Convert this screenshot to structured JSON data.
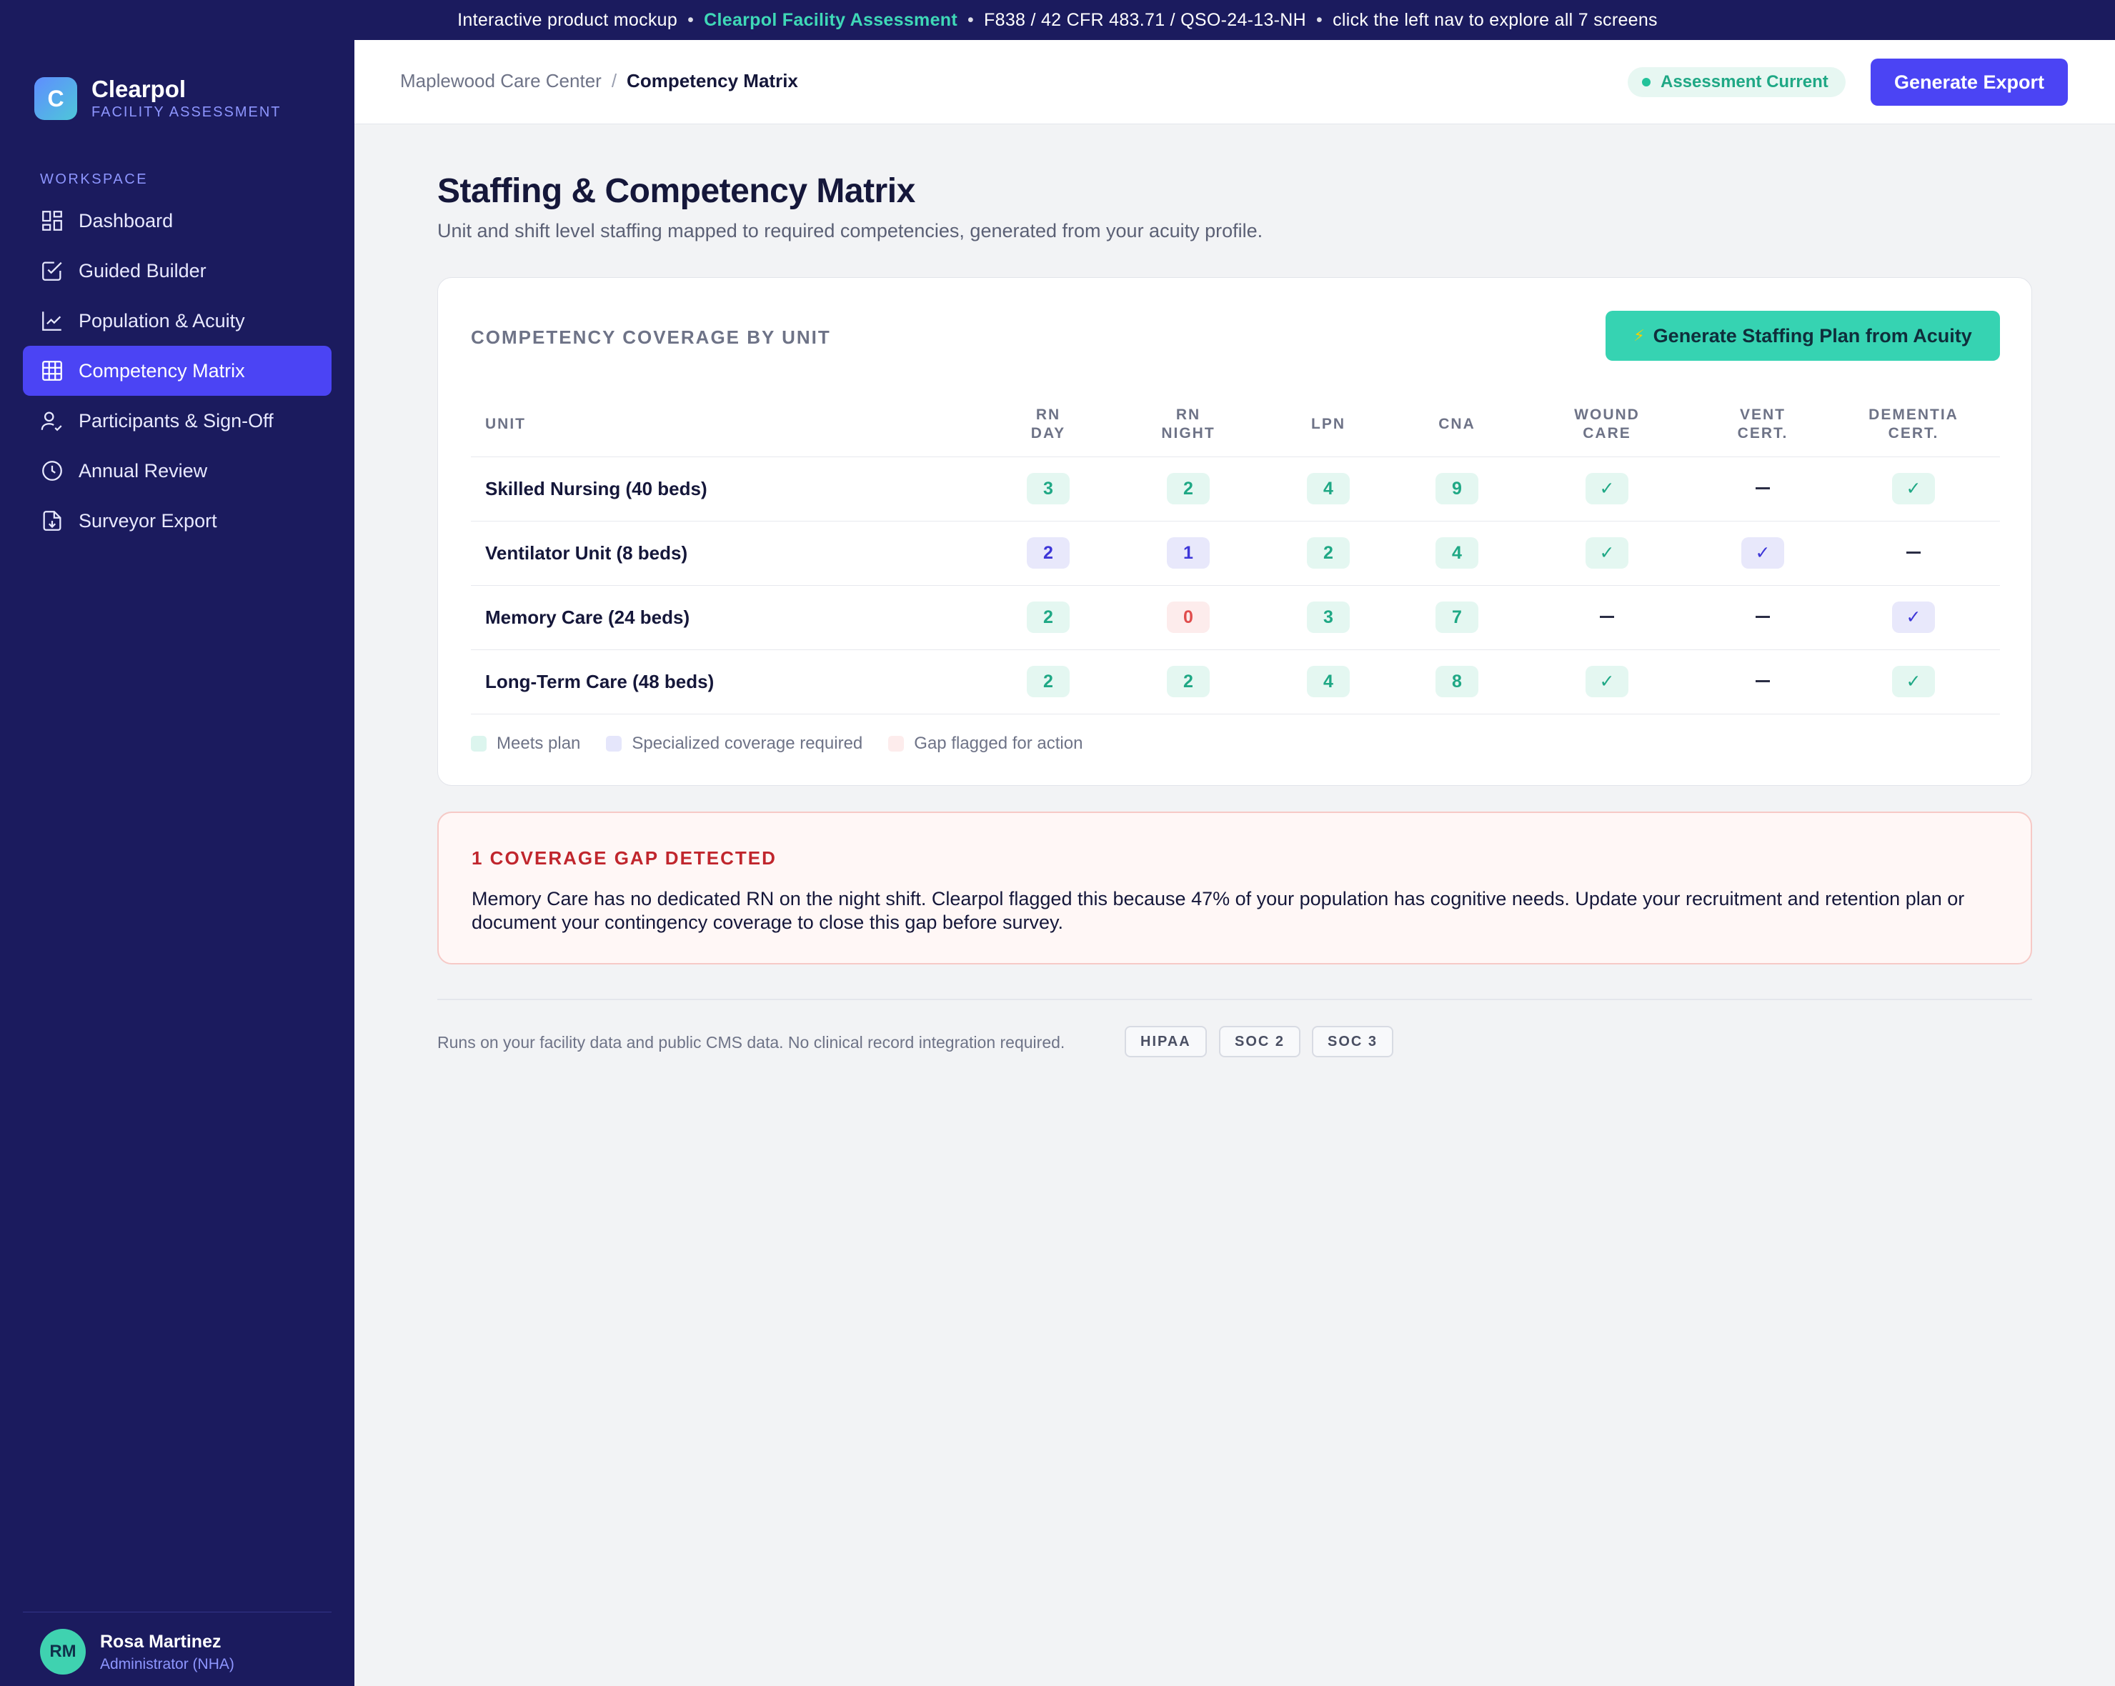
{
  "banner": {
    "prefix": "Interactive product mockup",
    "brand": "Clearpol Facility Assessment",
    "regulation": "F838 / 42 CFR 483.71 / QSO-24-13-NH",
    "hint": "click the left nav to explore all 7 screens",
    "separator": "•"
  },
  "sidebar": {
    "logo_letter": "C",
    "app_name": "Clearpol",
    "app_subtitle": "FACILITY ASSESSMENT",
    "section_label": "WORKSPACE",
    "items": [
      {
        "label": "Dashboard",
        "icon": "dashboard-icon"
      },
      {
        "label": "Guided Builder",
        "icon": "checklist-icon"
      },
      {
        "label": "Population & Acuity",
        "icon": "line-chart-icon"
      },
      {
        "label": "Competency Matrix",
        "icon": "grid-icon",
        "active": true
      },
      {
        "label": "Participants & Sign-Off",
        "icon": "user-check-icon"
      },
      {
        "label": "Annual Review",
        "icon": "clock-icon"
      },
      {
        "label": "Surveyor Export",
        "icon": "file-download-icon"
      }
    ],
    "user": {
      "initials": "RM",
      "name": "Rosa Martinez",
      "role": "Administrator (NHA)"
    }
  },
  "header": {
    "breadcrumb_parent": "Maplewood Care Center",
    "breadcrumb_sep": "/",
    "breadcrumb_current": "Competency Matrix",
    "status": "Assessment Current",
    "export_label": "Generate Export"
  },
  "page": {
    "title": "Staffing & Competency Matrix",
    "subtitle": "Unit and shift level staffing mapped to required competencies, generated from your acuity profile."
  },
  "matrix": {
    "title": "COMPETENCY COVERAGE BY UNIT",
    "action_label": "Generate Staffing Plan from Acuity",
    "action_icon": "⚡",
    "columns": [
      {
        "l1": "UNIT",
        "l2": ""
      },
      {
        "l1": "RN",
        "l2": "DAY"
      },
      {
        "l1": "RN",
        "l2": "NIGHT"
      },
      {
        "l1": "LPN",
        "l2": ""
      },
      {
        "l1": "CNA",
        "l2": ""
      },
      {
        "l1": "WOUND",
        "l2": "CARE"
      },
      {
        "l1": "VENT",
        "l2": "CERT."
      },
      {
        "l1": "DEMENTIA",
        "l2": "CERT."
      }
    ],
    "rows": [
      {
        "unit": "Skilled Nursing (40 beds)",
        "cells": [
          {
            "v": "3",
            "s": "meets"
          },
          {
            "v": "2",
            "s": "meets"
          },
          {
            "v": "4",
            "s": "meets"
          },
          {
            "v": "9",
            "s": "meets"
          },
          {
            "v": "✓",
            "s": "meets"
          },
          {
            "v": "",
            "s": "none"
          },
          {
            "v": "✓",
            "s": "meets"
          }
        ]
      },
      {
        "unit": "Ventilator Unit (8 beds)",
        "cells": [
          {
            "v": "2",
            "s": "special"
          },
          {
            "v": "1",
            "s": "special"
          },
          {
            "v": "2",
            "s": "meets"
          },
          {
            "v": "4",
            "s": "meets"
          },
          {
            "v": "✓",
            "s": "meets"
          },
          {
            "v": "✓",
            "s": "special"
          },
          {
            "v": "",
            "s": "none"
          }
        ]
      },
      {
        "unit": "Memory Care (24 beds)",
        "cells": [
          {
            "v": "2",
            "s": "meets"
          },
          {
            "v": "0",
            "s": "gap"
          },
          {
            "v": "3",
            "s": "meets"
          },
          {
            "v": "7",
            "s": "meets"
          },
          {
            "v": "",
            "s": "none"
          },
          {
            "v": "",
            "s": "none"
          },
          {
            "v": "✓",
            "s": "special"
          }
        ]
      },
      {
        "unit": "Long-Term Care (48 beds)",
        "cells": [
          {
            "v": "2",
            "s": "meets"
          },
          {
            "v": "2",
            "s": "meets"
          },
          {
            "v": "4",
            "s": "meets"
          },
          {
            "v": "8",
            "s": "meets"
          },
          {
            "v": "✓",
            "s": "meets"
          },
          {
            "v": "",
            "s": "none"
          },
          {
            "v": "✓",
            "s": "meets"
          }
        ]
      }
    ],
    "legend": [
      {
        "label": "Meets plan",
        "s": "meets"
      },
      {
        "label": "Specialized coverage required",
        "s": "special"
      },
      {
        "label": "Gap flagged for action",
        "s": "gap"
      }
    ]
  },
  "alert": {
    "title": "1 COVERAGE GAP DETECTED",
    "body": "Memory Care has no dedicated RN on the night shift. Clearpol flagged this because 47% of your population has cognitive needs. Update your recruitment and retention plan or document your contingency coverage to close this gap before survey."
  },
  "footer": {
    "text": "Runs on your facility data and public CMS data. No clinical record integration required.",
    "certs": [
      "HIPAA",
      "SOC 2",
      "SOC 3"
    ]
  },
  "colors": {
    "sidebar_bg": "#1b1b5e",
    "accent": "#4b44f4",
    "teal": "#36d3b2",
    "gap_red": "#c0262d"
  }
}
